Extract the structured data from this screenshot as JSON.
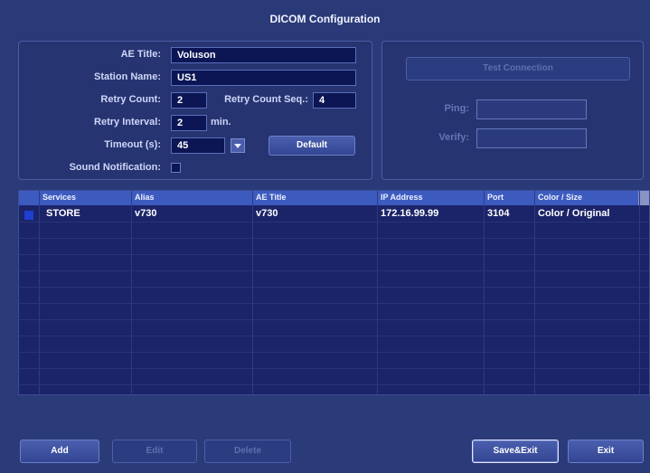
{
  "window": {
    "title": "DICOM Configuration"
  },
  "config": {
    "ae_title_label": "AE Title:",
    "ae_title_value": "Voluson",
    "station_name_label": "Station Name:",
    "station_name_value": "US1",
    "retry_count_label": "Retry Count:",
    "retry_count_value": "2",
    "retry_count_seq_label": "Retry Count Seq.:",
    "retry_count_seq_value": "4",
    "retry_interval_label": "Retry Interval:",
    "retry_interval_value": "2",
    "retry_interval_unit": "min.",
    "timeout_label": "Timeout (s):",
    "timeout_value": "45",
    "default_button": "Default",
    "sound_notification_label": "Sound Notification:"
  },
  "test": {
    "test_connection_button": "Test Connection",
    "ping_label": "Ping:",
    "verify_label": "Verify:"
  },
  "table": {
    "headers": [
      "Services",
      "Alias",
      "AE Title",
      "IP Address",
      "Port",
      "Color / Size"
    ],
    "rows": [
      {
        "service": "STORE",
        "alias": "v730",
        "ae_title": "v730",
        "ip": "172.16.99.99",
        "port": "3104",
        "color_size": "Color / Original"
      }
    ]
  },
  "buttons": {
    "add": "Add",
    "edit": "Edit",
    "delete": "Delete",
    "save_exit": "Save&Exit",
    "exit": "Exit"
  }
}
